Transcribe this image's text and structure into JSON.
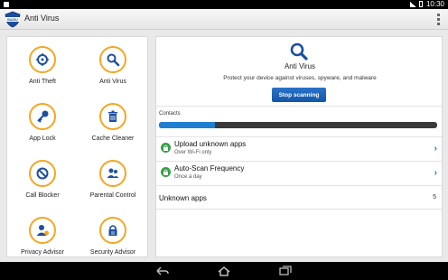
{
  "status_bar": {
    "time": "10:30"
  },
  "app": {
    "title": "Anti Virus",
    "logo_text": "BAIDU"
  },
  "grid": {
    "items": [
      {
        "label": "Anti Theft",
        "icon": "target-icon"
      },
      {
        "label": "Anti Virus",
        "icon": "search-icon"
      },
      {
        "label": "App Lock",
        "icon": "key-icon"
      },
      {
        "label": "Cache Cleaner",
        "icon": "trash-icon"
      },
      {
        "label": "Call Blocker",
        "icon": "block-icon"
      },
      {
        "label": "Parental Control",
        "icon": "people-icon"
      },
      {
        "label": "Privacy Advisor",
        "icon": "privacy-icon"
      },
      {
        "label": "Security Advisor",
        "icon": "security-icon"
      }
    ]
  },
  "scan": {
    "title": "Anti Virus",
    "subtitle": "Protect your device against viruses, spyware, and malware",
    "button_label": "Stop scanning",
    "progress_label": "Contacts",
    "progress_fraction": 0.2
  },
  "settings": [
    {
      "title": "Upload unknown apps",
      "subtitle": "Over Wi-Fi only"
    },
    {
      "title": "Auto-Scan Frequency",
      "subtitle": "Once a day"
    }
  ],
  "unknown_apps": {
    "label": "Unknown apps",
    "count": "5"
  },
  "colors": {
    "accent_orange": "#f5a623",
    "button_blue": "#1356a8",
    "progress_blue": "#1f7ed0",
    "lock_green": "#35a046"
  }
}
